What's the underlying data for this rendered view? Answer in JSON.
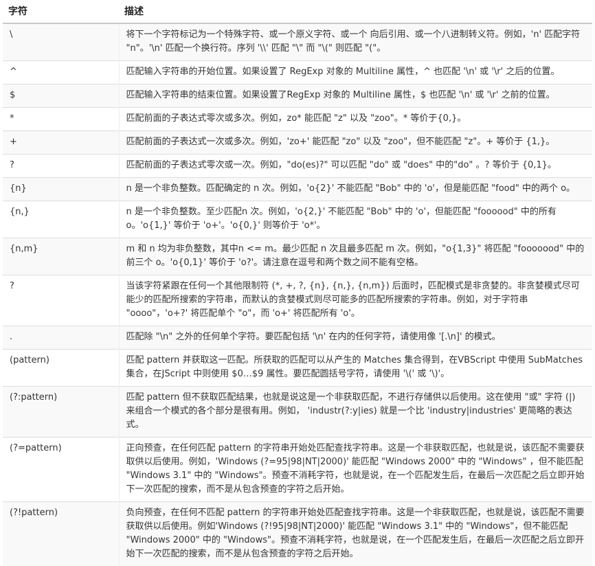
{
  "header": {
    "col1": "字符",
    "col2": "描述"
  },
  "rows": [
    {
      "char": "\\",
      "desc": "将下一个字符标记为一个特殊字符、或一个原义字符、或一个 向后引用、或一个八进制转义符。例如，'n' 匹配字符 \"n\"。'\\n' 匹配一个换行符。序列 '\\\\' 匹配 \"\\\" 而 \"\\(\" 则匹配 \"(\"。"
    },
    {
      "char": "^",
      "desc": "匹配输入字符串的开始位置。如果设置了 RegExp 对象的 Multiline 属性，^ 也匹配 '\\n' 或 '\\r' 之后的位置。"
    },
    {
      "char": "$",
      "desc": "匹配输入字符串的结束位置。如果设置了RegExp 对象的 Multiline 属性，$ 也匹配 '\\n' 或 '\\r' 之前的位置。"
    },
    {
      "char": "*",
      "desc": "匹配前面的子表达式零次或多次。例如，zo* 能匹配 \"z\" 以及 \"zoo\"。* 等价于{0,}。"
    },
    {
      "char": "+",
      "desc": "匹配前面的子表达式一次或多次。例如，'zo+' 能匹配 \"zo\" 以及 \"zoo\"，但不能匹配 \"z\"。+ 等价于 {1,}。"
    },
    {
      "char": "?",
      "desc": "匹配前面的子表达式零次或一次。例如，\"do(es)?\" 可以匹配 \"do\" 或 \"does\" 中的\"do\" 。? 等价于 {0,1}。"
    },
    {
      "char": "{n}",
      "desc": "n 是一个非负整数。匹配确定的 n 次。例如，'o{2}' 不能匹配 \"Bob\" 中的 'o'，但是能匹配 \"food\" 中的两个 o。"
    },
    {
      "char": "{n,}",
      "desc": "n 是一个非负整数。至少匹配n 次。例如，'o{2,}' 不能匹配 \"Bob\" 中的 'o'，但能匹配 \"foooood\" 中的所有 o。'o{1,}' 等价于 'o+'。'o{0,}' 则等价于 'o*'。"
    },
    {
      "char": "{n,m}",
      "desc": "m 和 n 均为非负整数，其中n <= m。最少匹配 n 次且最多匹配 m 次。例如，\"o{1,3}\" 将匹配 \"fooooood\" 中的前三个 o。'o{0,1}' 等价于 'o?'。请注意在逗号和两个数之间不能有空格。"
    },
    {
      "char": "?",
      "desc": "当该字符紧跟在任何一个其他限制符 (*, +, ?, {n}, {n,}, {n,m}) 后面时，匹配模式是非贪婪的。非贪婪模式尽可能少的匹配所搜索的字符串，而默认的贪婪模式则尽可能多的匹配所搜索的字符串。例如，对于字符串 \"oooo\"，'o+?' 将匹配单个 \"o\"，而 'o+' 将匹配所有 'o'。"
    },
    {
      "char": ".",
      "desc": "匹配除 \"\\n\" 之外的任何单个字符。要匹配包括 '\\n' 在内的任何字符，请使用像 '[.\\n]' 的模式。"
    },
    {
      "char": "(pattern)",
      "desc": "匹配 pattern 并获取这一匹配。所获取的匹配可以从产生的 Matches 集合得到，在VBScript 中使用 SubMatches 集合，在JScript 中则使用 $0…$9 属性。要匹配圆括号字符，请使用 '\\(' 或 '\\)'。"
    },
    {
      "char": "(?:pattern)",
      "desc": "匹配 pattern 但不获取匹配结果，也就是说这是一个非获取匹配，不进行存储供以后使用。这在使用 \"或\" 字符 (|) 来组合一个模式的各个部分是很有用。例如， 'industr(?:y|ies) 就是一个比 'industry|industries' 更简略的表达式。"
    },
    {
      "char": "(?=pattern)",
      "desc": "正向预查，在任何匹配 pattern 的字符串开始处匹配查找字符串。这是一个非获取匹配，也就是说，该匹配不需要获取供以后使用。例如，'Windows (?=95|98|NT|2000)' 能匹配 \"Windows 2000\" 中的 \"Windows\" ，但不能匹配 \"Windows 3.1\" 中的 \"Windows\"。预查不消耗字符，也就是说，在一个匹配发生后，在最后一次匹配之后立即开始下一次匹配的搜索，而不是从包含预查的字符之后开始。"
    },
    {
      "char": "(?!pattern)",
      "desc": "负向预查，在任何不匹配 pattern 的字符串开始处匹配查找字符串。这是一个非获取匹配，也就是说，该匹配不需要获取供以后使用。例如'Windows (?!95|98|NT|2000)' 能匹配 \"Windows 3.1\" 中的 \"Windows\"，但不能匹配 \"Windows 2000\" 中的 \"Windows\"。预查不消耗字符，也就是说，在一个匹配发生后，在最后一次匹配之后立即开始下一次匹配的搜索，而不是从包含预查的字符之后开始。"
    }
  ]
}
